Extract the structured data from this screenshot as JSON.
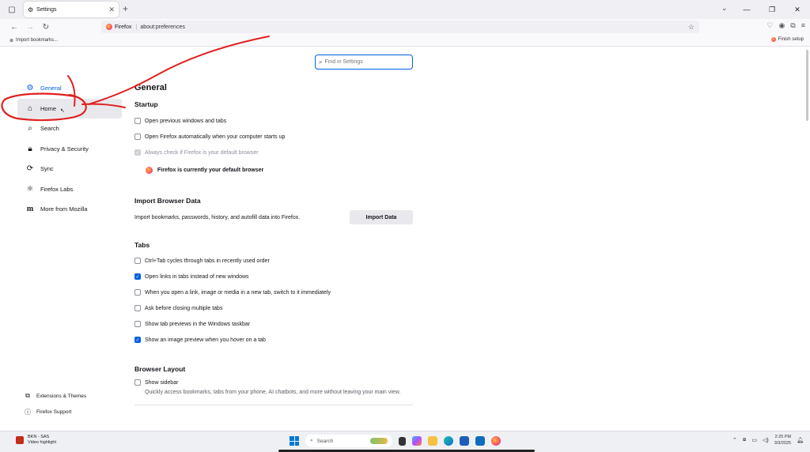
{
  "tab": {
    "title": "Settings"
  },
  "nav": {
    "identity_label": "Firefox",
    "url": "about:preferences"
  },
  "bookmarks": {
    "import_label": "Import bookmarks...",
    "finish_setup": "Finish setup"
  },
  "search": {
    "placeholder": "Find in Settings"
  },
  "sidebar": {
    "categories": [
      {
        "label": "General"
      },
      {
        "label": "Home"
      },
      {
        "label": "Search"
      },
      {
        "label": "Privacy & Security"
      },
      {
        "label": "Sync"
      },
      {
        "label": "Firefox Labs"
      },
      {
        "label": "More from Mozilla"
      }
    ],
    "footer": [
      {
        "label": "Extensions & Themes"
      },
      {
        "label": "Firefox Support"
      }
    ]
  },
  "main": {
    "title": "General",
    "startup": {
      "title": "Startup",
      "options": [
        {
          "label": "Open previous windows and tabs",
          "checked": false
        },
        {
          "label": "Open Firefox automatically when your computer starts up",
          "checked": false
        },
        {
          "label": "Always check if Firefox is your default browser",
          "checked": true,
          "disabled": true
        }
      ],
      "default_status": "Firefox is currently your default browser"
    },
    "import": {
      "title": "Import Browser Data",
      "description": "Import bookmarks, passwords, history, and autofill data into Firefox.",
      "button": "Import Data"
    },
    "tabs": {
      "title": "Tabs",
      "options": [
        {
          "label": "Ctrl+Tab cycles through tabs in recently used order",
          "checked": false
        },
        {
          "label": "Open links in tabs instead of new windows",
          "checked": true
        },
        {
          "label": "When you open a link, image or media in a new tab, switch to it immediately",
          "checked": false
        },
        {
          "label": "Ask before closing multiple tabs",
          "checked": false
        },
        {
          "label": "Show tab previews in the Windows taskbar",
          "checked": false
        },
        {
          "label": "Show an image preview when you hover on a tab",
          "checked": true
        }
      ]
    },
    "layout": {
      "title": "Browser Layout",
      "option": {
        "label": "Show sidebar",
        "checked": false
      },
      "description": "Quickly access bookmarks, tabs from your phone, AI chatbots, and more without leaving your main view."
    }
  },
  "taskbar": {
    "notification_title": "BKN - SAS",
    "notification_sub": "Video highlight",
    "search_placeholder": "Search",
    "time": "2:25 PM",
    "date": "3/3/2025"
  },
  "colors": {
    "accent": "#0061e0",
    "annotation": "#e02020"
  }
}
